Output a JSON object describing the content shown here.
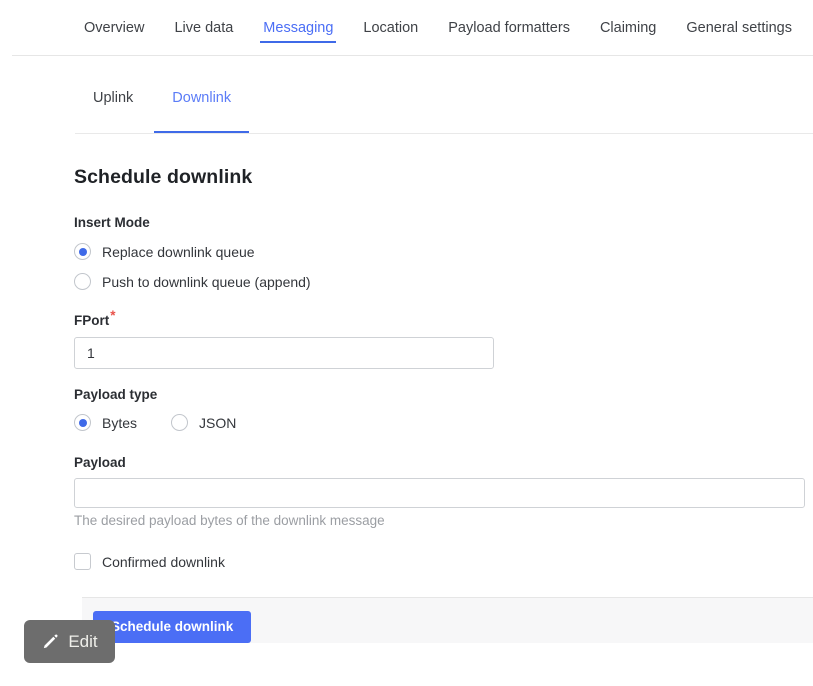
{
  "topnav": {
    "items": [
      {
        "label": "Overview",
        "active": false
      },
      {
        "label": "Live data",
        "active": false
      },
      {
        "label": "Messaging",
        "active": true
      },
      {
        "label": "Location",
        "active": false
      },
      {
        "label": "Payload formatters",
        "active": false
      },
      {
        "label": "Claiming",
        "active": false
      },
      {
        "label": "General settings",
        "active": false
      }
    ]
  },
  "subnav": {
    "items": [
      {
        "label": "Uplink",
        "active": false
      },
      {
        "label": "Downlink",
        "active": true
      }
    ]
  },
  "form": {
    "title": "Schedule downlink",
    "insert_mode": {
      "label": "Insert Mode",
      "options": [
        {
          "label": "Replace downlink queue",
          "selected": true
        },
        {
          "label": "Push to downlink queue (append)",
          "selected": false
        }
      ]
    },
    "fport": {
      "label": "FPort",
      "required_marker": "*",
      "value": "1",
      "placeholder": ""
    },
    "payload_type": {
      "label": "Payload type",
      "options": [
        {
          "label": "Bytes",
          "selected": true
        },
        {
          "label": "JSON",
          "selected": false
        }
      ]
    },
    "payload": {
      "label": "Payload",
      "value": "",
      "placeholder": "",
      "helper_text": "The desired payload bytes of the downlink message"
    },
    "confirmed_downlink": {
      "label": "Confirmed downlink",
      "checked": false
    },
    "submit_label": "Schedule downlink"
  },
  "overlay": {
    "edit_label": "Edit",
    "icon": "pencil-icon"
  },
  "colors": {
    "accent_blue": "#4b6ef5",
    "tab_underline": "#3f6ae8",
    "required_red": "#e8524a",
    "overlay_gray": "#6d6d6d",
    "footer_bg": "#f7f7f8"
  }
}
